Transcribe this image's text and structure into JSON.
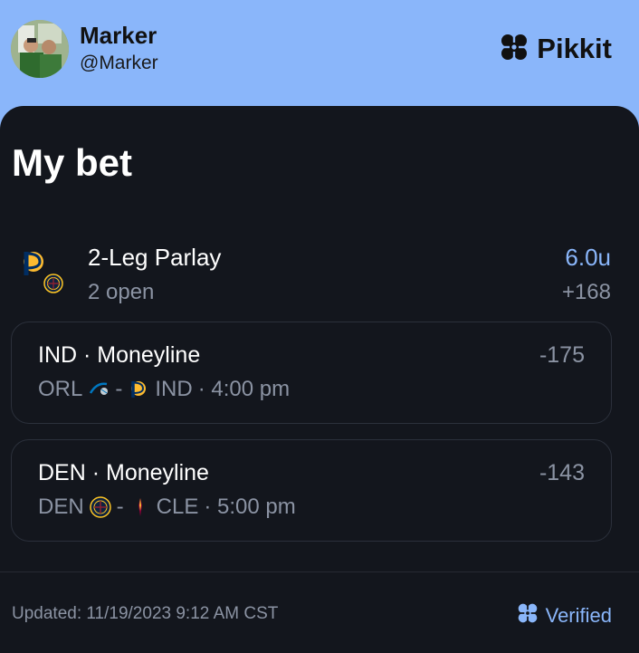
{
  "header": {
    "user_name": "Marker",
    "user_handle": "@Marker",
    "brand_name": "Pikkit"
  },
  "bet": {
    "heading": "My bet",
    "parlay_title": "2-Leg Parlay",
    "parlay_status": "2 open",
    "units": "6.0u",
    "odds": "+168",
    "legs": [
      {
        "title": "IND · Moneyline",
        "odds": "-175",
        "away": "ORL",
        "separator": "-",
        "home": "IND",
        "time": "· 4:00 pm",
        "away_icon": "orlando-magic-logo-icon",
        "home_icon": "indiana-pacers-logo-icon"
      },
      {
        "title": "DEN · Moneyline",
        "odds": "-143",
        "away": "DEN",
        "separator": "-",
        "home": "CLE",
        "time": "· 5:00 pm",
        "away_icon": "denver-nuggets-logo-icon",
        "home_icon": "cleveland-cavaliers-logo-icon"
      }
    ]
  },
  "footer": {
    "updated": "Updated: 11/19/2023 9:12 AM CST",
    "verified": "Verified"
  },
  "colors": {
    "header_bg": "#8ab6fa",
    "card_bg": "#13161d",
    "accent": "#8ab6fa",
    "muted_text": "#8b93a3"
  }
}
